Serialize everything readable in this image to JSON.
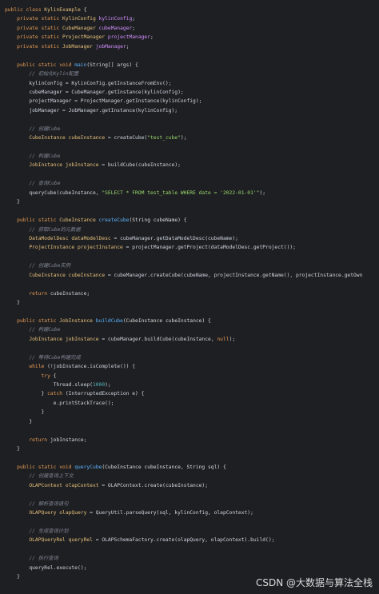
{
  "code": {
    "lines": [
      [
        {
          "t": "public class ",
          "c": "kw"
        },
        {
          "t": "KylinExample",
          "c": "ty"
        },
        {
          "t": " {",
          "c": "op"
        }
      ],
      [
        {
          "t": "    private static ",
          "c": "kw"
        },
        {
          "t": "KylinConfig ",
          "c": "ty"
        },
        {
          "t": "kylinConfig",
          "c": "vr"
        },
        {
          "t": ";",
          "c": "op"
        }
      ],
      [
        {
          "t": "    private static ",
          "c": "kw"
        },
        {
          "t": "CubeManager ",
          "c": "ty"
        },
        {
          "t": "cubeManager",
          "c": "vr"
        },
        {
          "t": ";",
          "c": "op"
        }
      ],
      [
        {
          "t": "    private static ",
          "c": "kw"
        },
        {
          "t": "ProjectManager ",
          "c": "ty"
        },
        {
          "t": "projectManager",
          "c": "vr"
        },
        {
          "t": ";",
          "c": "op"
        }
      ],
      [
        {
          "t": "    private static ",
          "c": "kw"
        },
        {
          "t": "JobManager ",
          "c": "ty"
        },
        {
          "t": "jobManager",
          "c": "vr"
        },
        {
          "t": ";",
          "c": "op"
        }
      ],
      [
        {
          "t": "",
          "c": "op"
        }
      ],
      [
        {
          "t": "    public static void ",
          "c": "kw"
        },
        {
          "t": "main",
          "c": "fn"
        },
        {
          "t": "(String[] args) {",
          "c": "op"
        }
      ],
      [
        {
          "t": "        // 初始化Kylin配置",
          "c": "cm"
        }
      ],
      [
        {
          "t": "        kylinConfig = KylinConfig.getInstanceFromEnv();",
          "c": "tx"
        }
      ],
      [
        {
          "t": "        cubeManager = CubeManager.getInstance(kylinConfig);",
          "c": "tx"
        }
      ],
      [
        {
          "t": "        projectManager = ProjectManager.getInstance(kylinConfig);",
          "c": "tx"
        }
      ],
      [
        {
          "t": "        jobManager = JobManager.getInstance(kylinConfig);",
          "c": "tx"
        }
      ],
      [
        {
          "t": "",
          "c": "op"
        }
      ],
      [
        {
          "t": "        // 创建Cube",
          "c": "cm"
        }
      ],
      [
        {
          "t": "        CubeInstance cubeInstance ",
          "c": "ty"
        },
        {
          "t": "= createCube(",
          "c": "tx"
        },
        {
          "t": "\"test_cube\"",
          "c": "st"
        },
        {
          "t": ");",
          "c": "tx"
        }
      ],
      [
        {
          "t": "",
          "c": "op"
        }
      ],
      [
        {
          "t": "        // 构建Cube",
          "c": "cm"
        }
      ],
      [
        {
          "t": "        JobInstance jobInstance ",
          "c": "ty"
        },
        {
          "t": "= buildCube(cubeInstance);",
          "c": "tx"
        }
      ],
      [
        {
          "t": "",
          "c": "op"
        }
      ],
      [
        {
          "t": "        // 查询Cube",
          "c": "cm"
        }
      ],
      [
        {
          "t": "        queryCube(cubeInstance, ",
          "c": "tx"
        },
        {
          "t": "\"SELECT * FROM test_table WHERE date = '2022-01-01'\"",
          "c": "st"
        },
        {
          "t": ");",
          "c": "tx"
        }
      ],
      [
        {
          "t": "    }",
          "c": "op"
        }
      ],
      [
        {
          "t": "",
          "c": "op"
        }
      ],
      [
        {
          "t": "    public static ",
          "c": "kw"
        },
        {
          "t": "CubeInstance ",
          "c": "ty"
        },
        {
          "t": "createCube",
          "c": "fn"
        },
        {
          "t": "(String cubeName) {",
          "c": "op"
        }
      ],
      [
        {
          "t": "        // 获取Cube的元数据",
          "c": "cm"
        }
      ],
      [
        {
          "t": "        DataModelDesc dataModelDesc ",
          "c": "ty"
        },
        {
          "t": "= cubeManager.getDataModelDesc(cubeName);",
          "c": "tx"
        }
      ],
      [
        {
          "t": "        ProjectInstance projectInstance ",
          "c": "ty"
        },
        {
          "t": "= projectManager.getProject(dataModelDesc.getProject());",
          "c": "tx"
        }
      ],
      [
        {
          "t": "",
          "c": "op"
        }
      ],
      [
        {
          "t": "        // 创建Cube实例",
          "c": "cm"
        }
      ],
      [
        {
          "t": "        CubeInstance cubeInstance ",
          "c": "ty"
        },
        {
          "t": "= cubeManager.createCube(cubeName, projectInstance.getName(), projectInstance.getOwn",
          "c": "tx"
        }
      ],
      [
        {
          "t": "",
          "c": "op"
        }
      ],
      [
        {
          "t": "        return ",
          "c": "kw"
        },
        {
          "t": "cubeInstance;",
          "c": "tx"
        }
      ],
      [
        {
          "t": "    }",
          "c": "op"
        }
      ],
      [
        {
          "t": "",
          "c": "op"
        }
      ],
      [
        {
          "t": "    public static ",
          "c": "kw"
        },
        {
          "t": "JobInstance ",
          "c": "ty"
        },
        {
          "t": "buildCube",
          "c": "fn"
        },
        {
          "t": "(CubeInstance cubeInstance) {",
          "c": "op"
        }
      ],
      [
        {
          "t": "        // 构建Cube",
          "c": "cm"
        }
      ],
      [
        {
          "t": "        JobInstance jobInstance ",
          "c": "ty"
        },
        {
          "t": "= cubeManager.buildCube(cubeInstance, ",
          "c": "tx"
        },
        {
          "t": "null",
          "c": "kw"
        },
        {
          "t": ");",
          "c": "tx"
        }
      ],
      [
        {
          "t": "",
          "c": "op"
        }
      ],
      [
        {
          "t": "        // 等待Cube构建完成",
          "c": "cm"
        }
      ],
      [
        {
          "t": "        while ",
          "c": "kw"
        },
        {
          "t": "(!jobInstance.isComplete()) {",
          "c": "tx"
        }
      ],
      [
        {
          "t": "            try ",
          "c": "kw"
        },
        {
          "t": "{",
          "c": "op"
        }
      ],
      [
        {
          "t": "                Thread.sleep(",
          "c": "tx"
        },
        {
          "t": "1000",
          "c": "nm"
        },
        {
          "t": ");",
          "c": "tx"
        }
      ],
      [
        {
          "t": "            } ",
          "c": "op"
        },
        {
          "t": "catch ",
          "c": "kw"
        },
        {
          "t": "(InterruptedException e) {",
          "c": "tx"
        }
      ],
      [
        {
          "t": "                e.printStackTrace();",
          "c": "tx"
        }
      ],
      [
        {
          "t": "            }",
          "c": "op"
        }
      ],
      [
        {
          "t": "        }",
          "c": "op"
        }
      ],
      [
        {
          "t": "",
          "c": "op"
        }
      ],
      [
        {
          "t": "        return ",
          "c": "kw"
        },
        {
          "t": "jobInstance;",
          "c": "tx"
        }
      ],
      [
        {
          "t": "    }",
          "c": "op"
        }
      ],
      [
        {
          "t": "",
          "c": "op"
        }
      ],
      [
        {
          "t": "    public static void ",
          "c": "kw"
        },
        {
          "t": "queryCube",
          "c": "fn"
        },
        {
          "t": "(CubeInstance cubeInstance, String sql) {",
          "c": "op"
        }
      ],
      [
        {
          "t": "        // 创建查询上下文",
          "c": "cm"
        }
      ],
      [
        {
          "t": "        OLAPContext olapContext ",
          "c": "ty"
        },
        {
          "t": "= OLAPContext.create(cubeInstance);",
          "c": "tx"
        }
      ],
      [
        {
          "t": "",
          "c": "op"
        }
      ],
      [
        {
          "t": "        // 解析查询语句",
          "c": "cm"
        }
      ],
      [
        {
          "t": "        OLAPQuery olapQuery ",
          "c": "ty"
        },
        {
          "t": "= QueryUtil.parseQuery(sql, kylinConfig, olapContext);",
          "c": "tx"
        }
      ],
      [
        {
          "t": "",
          "c": "op"
        }
      ],
      [
        {
          "t": "        // 生成查询计划",
          "c": "cm"
        }
      ],
      [
        {
          "t": "        OLAPQueryRel queryRel ",
          "c": "ty"
        },
        {
          "t": "= OLAPSchemaFactory.create(olapQuery, olapContext).build();",
          "c": "tx"
        }
      ],
      [
        {
          "t": "",
          "c": "op"
        }
      ],
      [
        {
          "t": "        // 执行查询",
          "c": "cm"
        }
      ],
      [
        {
          "t": "        queryRel.execute();",
          "c": "tx"
        }
      ],
      [
        {
          "t": "    }",
          "c": "op"
        }
      ]
    ]
  },
  "watermark": "CSDN @大数据与算法全栈"
}
